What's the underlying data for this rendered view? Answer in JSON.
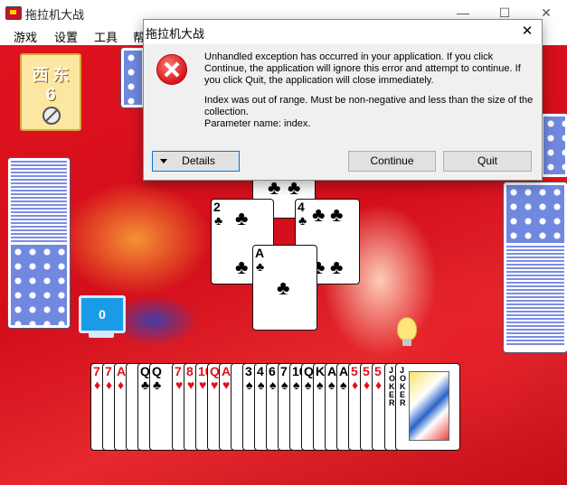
{
  "window": {
    "title": "拖拉机大战",
    "controls": [
      "—",
      "☐",
      "✕"
    ]
  },
  "menu": {
    "items": [
      "游戏",
      "设置",
      "工具",
      "帮"
    ]
  },
  "game": {
    "tile": {
      "top": "西 东",
      "number": "6"
    },
    "monitor_value": "0",
    "center_cards": [
      {
        "rank": "2",
        "suit": "♣"
      },
      {
        "rank": "4",
        "suit": "♣"
      },
      {
        "rank": "A",
        "suit": "♣"
      },
      {
        "rank": "",
        "suit": "♣"
      }
    ],
    "hand": [
      {
        "rank": "7",
        "suit": "♦",
        "color": "red"
      },
      {
        "rank": "7",
        "suit": "♦",
        "color": "red"
      },
      {
        "rank": "A",
        "suit": "♦",
        "color": "red"
      },
      {
        "rank": "",
        "suit": "",
        "color": "red"
      },
      {
        "rank": "Q",
        "suit": "♣",
        "color": "black"
      },
      {
        "rank": "Q",
        "suit": "♣",
        "color": "black"
      },
      {
        "rank": "7",
        "suit": "♥",
        "color": "red"
      },
      {
        "rank": "8",
        "suit": "♥",
        "color": "red"
      },
      {
        "rank": "10",
        "suit": "♥",
        "color": "red"
      },
      {
        "rank": "Q",
        "suit": "♥",
        "color": "red"
      },
      {
        "rank": "A",
        "suit": "♥",
        "color": "red"
      },
      {
        "rank": "",
        "suit": "",
        "color": "black"
      },
      {
        "rank": "3",
        "suit": "♠",
        "color": "black"
      },
      {
        "rank": "4",
        "suit": "♠",
        "color": "black"
      },
      {
        "rank": "6",
        "suit": "♠",
        "color": "black"
      },
      {
        "rank": "7",
        "suit": "♠",
        "color": "black"
      },
      {
        "rank": "10",
        "suit": "♠",
        "color": "black"
      },
      {
        "rank": "Q",
        "suit": "♠",
        "color": "black"
      },
      {
        "rank": "K",
        "suit": "♠",
        "color": "black"
      },
      {
        "rank": "A",
        "suit": "♠",
        "color": "black"
      },
      {
        "rank": "A",
        "suit": "♠",
        "color": "black"
      },
      {
        "rank": "5",
        "suit": "♦",
        "color": "red"
      },
      {
        "rank": "5",
        "suit": "♦",
        "color": "red"
      },
      {
        "rank": "5",
        "suit": "♦",
        "color": "red"
      }
    ],
    "jokers": [
      {
        "word": "JOKER",
        "color": "black"
      },
      {
        "word": "JOKER",
        "color": "black"
      }
    ]
  },
  "dialog": {
    "title": "拖拉机大战",
    "close": "✕",
    "message1": "Unhandled exception has occurred in your application. If you click Continue, the application will ignore this error and attempt to continue. If you click Quit, the application will close immediately.",
    "message2a": "Index was out of range. Must be non-negative and less than the size of the collection.",
    "message2b": "Parameter name: index.",
    "details_label": "Details",
    "continue_label": "Continue",
    "quit_label": "Quit"
  },
  "colors": {
    "table_red": "#d30f1b",
    "card_back_blue": "#7089df",
    "dialog_bg": "#f0f0f0",
    "focus_blue": "#0078d7"
  }
}
